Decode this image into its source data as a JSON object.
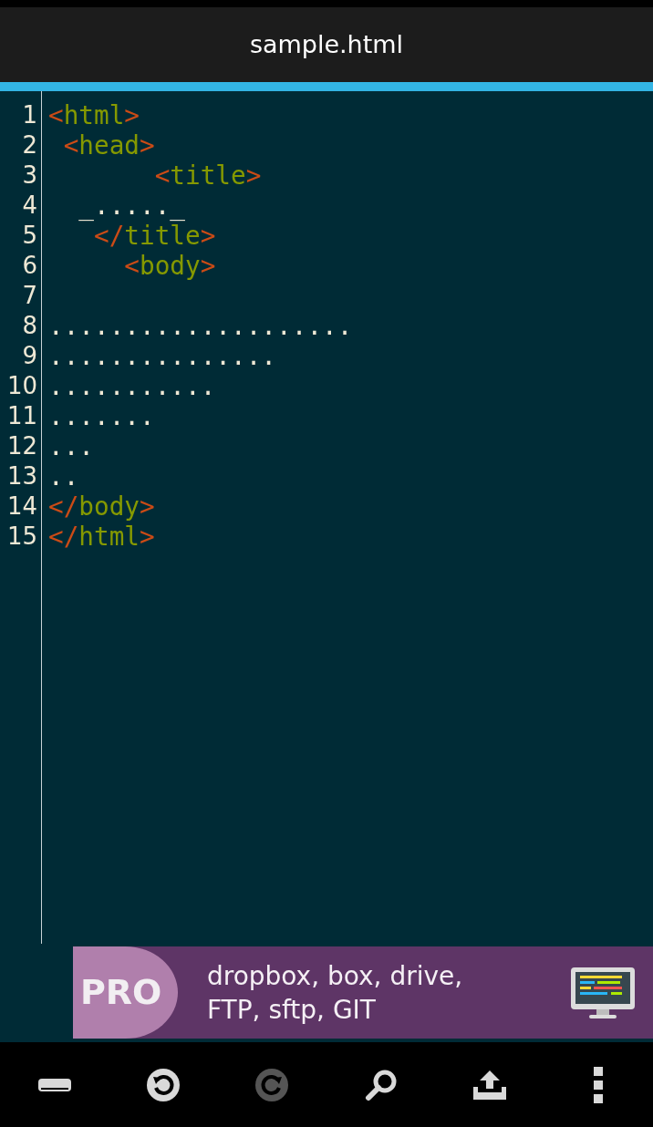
{
  "title": "sample.html",
  "lines": [
    {
      "number": "1",
      "segments": [
        {
          "kind": "punct",
          "text": "<"
        },
        {
          "kind": "tag",
          "text": "html"
        },
        {
          "kind": "punct",
          "text": ">"
        }
      ]
    },
    {
      "number": "2",
      "segments": [
        {
          "kind": "punct",
          "text": " <"
        },
        {
          "kind": "tag",
          "text": "head"
        },
        {
          "kind": "punct",
          "text": ">"
        }
      ]
    },
    {
      "number": "3",
      "segments": [
        {
          "kind": "punct",
          "text": "       <"
        },
        {
          "kind": "tag",
          "text": "title"
        },
        {
          "kind": "punct",
          "text": ">"
        }
      ]
    },
    {
      "number": "4",
      "segments": [
        {
          "kind": "text",
          "text": "  _....._"
        }
      ]
    },
    {
      "number": "5",
      "segments": [
        {
          "kind": "punct",
          "text": "   </"
        },
        {
          "kind": "tag",
          "text": "title"
        },
        {
          "kind": "punct",
          "text": ">"
        }
      ]
    },
    {
      "number": "6",
      "segments": [
        {
          "kind": "punct",
          "text": "     <"
        },
        {
          "kind": "tag",
          "text": "body"
        },
        {
          "kind": "punct",
          "text": ">"
        }
      ]
    },
    {
      "number": "7"
    },
    {
      "number": "8",
      "segments": [
        {
          "kind": "text",
          "text": "...................."
        }
      ]
    },
    {
      "number": "9",
      "segments": [
        {
          "kind": "text",
          "text": "..............."
        }
      ]
    },
    {
      "number": "10",
      "segments": [
        {
          "kind": "text",
          "text": "..........."
        }
      ]
    },
    {
      "number": "11",
      "segments": [
        {
          "kind": "text",
          "text": "......."
        }
      ]
    },
    {
      "number": "12",
      "segments": [
        {
          "kind": "text",
          "text": "..."
        }
      ]
    },
    {
      "number": "13",
      "segments": [
        {
          "kind": "text",
          "text": ".."
        }
      ]
    },
    {
      "number": "14",
      "segments": [
        {
          "kind": "punct",
          "text": "</"
        },
        {
          "kind": "tag",
          "text": "body"
        },
        {
          "kind": "punct",
          "text": ">"
        }
      ]
    },
    {
      "number": "15",
      "segments": [
        {
          "kind": "punct",
          "text": "</"
        },
        {
          "kind": "tag",
          "text": "html"
        },
        {
          "kind": "punct",
          "text": ">"
        }
      ]
    }
  ],
  "banner": {
    "badge": "PRO",
    "lines": [
      "dropbox, box, drive,",
      "FTP, sftp, GIT"
    ]
  },
  "toolbar": [
    {
      "kind": "files",
      "disabled": false
    },
    {
      "kind": "undo",
      "disabled": false
    },
    {
      "kind": "redo",
      "disabled": true
    },
    {
      "kind": "search",
      "disabled": false
    },
    {
      "kind": "share",
      "disabled": false
    },
    {
      "kind": "more",
      "disabled": false
    }
  ]
}
